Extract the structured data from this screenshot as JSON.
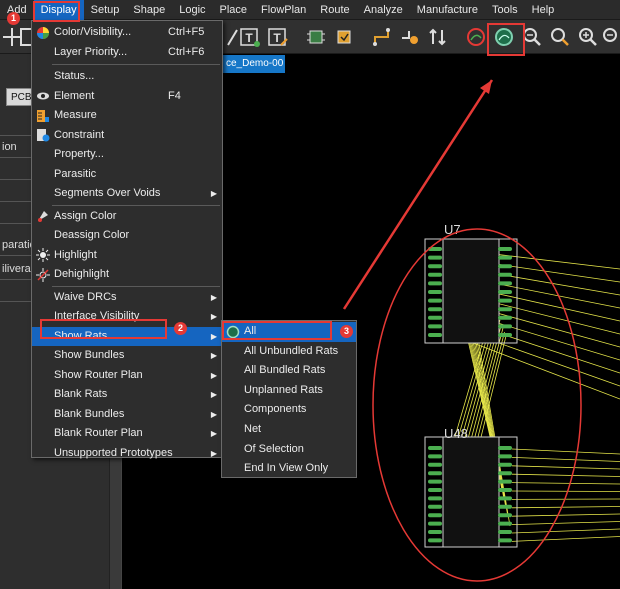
{
  "menubar": {
    "items": [
      "Add",
      "Display",
      "Setup",
      "Shape",
      "Logic",
      "Place",
      "FlowPlan",
      "Route",
      "Analyze",
      "Manufacture",
      "Tools",
      "Help"
    ]
  },
  "left_pane": {
    "pcb_label": "PCB",
    "rows": [
      "",
      "ion",
      "",
      "",
      "",
      "paratio",
      "iliverab",
      ""
    ]
  },
  "tab": {
    "label": "ce_Demo-00"
  },
  "display_menu": {
    "items": [
      {
        "label": "Color/Visibility...",
        "shortcut": "Ctrl+F5",
        "icon": "color-wheel-icon"
      },
      {
        "label": "Layer Priority...",
        "shortcut": "Ctrl+F6",
        "icon": ""
      },
      {
        "label": "Status...",
        "shortcut": "",
        "icon": ""
      },
      {
        "label": "Element",
        "shortcut": "F4",
        "icon": "eye-icon"
      },
      {
        "label": "Measure",
        "shortcut": "",
        "icon": "measure-icon"
      },
      {
        "label": "Constraint",
        "shortcut": "",
        "icon": "constraint-icon"
      },
      {
        "label": "Property...",
        "shortcut": "",
        "icon": ""
      },
      {
        "label": "Parasitic",
        "shortcut": "",
        "icon": ""
      },
      {
        "label": "Segments Over Voids",
        "shortcut": "",
        "icon": "",
        "submenu": true
      },
      {
        "label": "Assign Color",
        "shortcut": "",
        "icon": "assign-color-icon"
      },
      {
        "label": "Deassign Color",
        "shortcut": "",
        "icon": ""
      },
      {
        "label": "Highlight",
        "shortcut": "",
        "icon": "highlight-icon"
      },
      {
        "label": "Dehighlight",
        "shortcut": "",
        "icon": "dehighlight-icon"
      },
      {
        "label": "Waive DRCs",
        "shortcut": "",
        "icon": "",
        "submenu": true
      },
      {
        "label": "Interface Visibility",
        "shortcut": "",
        "icon": "",
        "submenu": true
      },
      {
        "label": "Show Rats",
        "shortcut": "",
        "icon": "",
        "submenu": true
      },
      {
        "label": "Show Bundles",
        "shortcut": "",
        "icon": "",
        "submenu": true
      },
      {
        "label": "Show Router Plan",
        "shortcut": "",
        "icon": "",
        "submenu": true
      },
      {
        "label": "Blank Rats",
        "shortcut": "",
        "icon": "",
        "submenu": true
      },
      {
        "label": "Blank Bundles",
        "shortcut": "",
        "icon": "",
        "submenu": true
      },
      {
        "label": "Blank Router Plan",
        "shortcut": "",
        "icon": "",
        "submenu": true
      },
      {
        "label": "Unsupported Prototypes",
        "shortcut": "",
        "icon": "",
        "submenu": true
      }
    ]
  },
  "show_rats_menu": {
    "items": [
      "All",
      "All Unbundled Rats",
      "All Bundled Rats",
      "Unplanned Rats",
      "Components",
      "Net",
      "Of Selection",
      "End In View Only"
    ]
  },
  "badges": [
    "1",
    "2",
    "3"
  ],
  "canvas": {
    "components": [
      "U7",
      "U48"
    ]
  },
  "colors": {
    "highlight": "#1565c0",
    "annotation_red": "#e53935",
    "rats_yellow": "#e5e54a",
    "pin_green": "#4caf50"
  }
}
